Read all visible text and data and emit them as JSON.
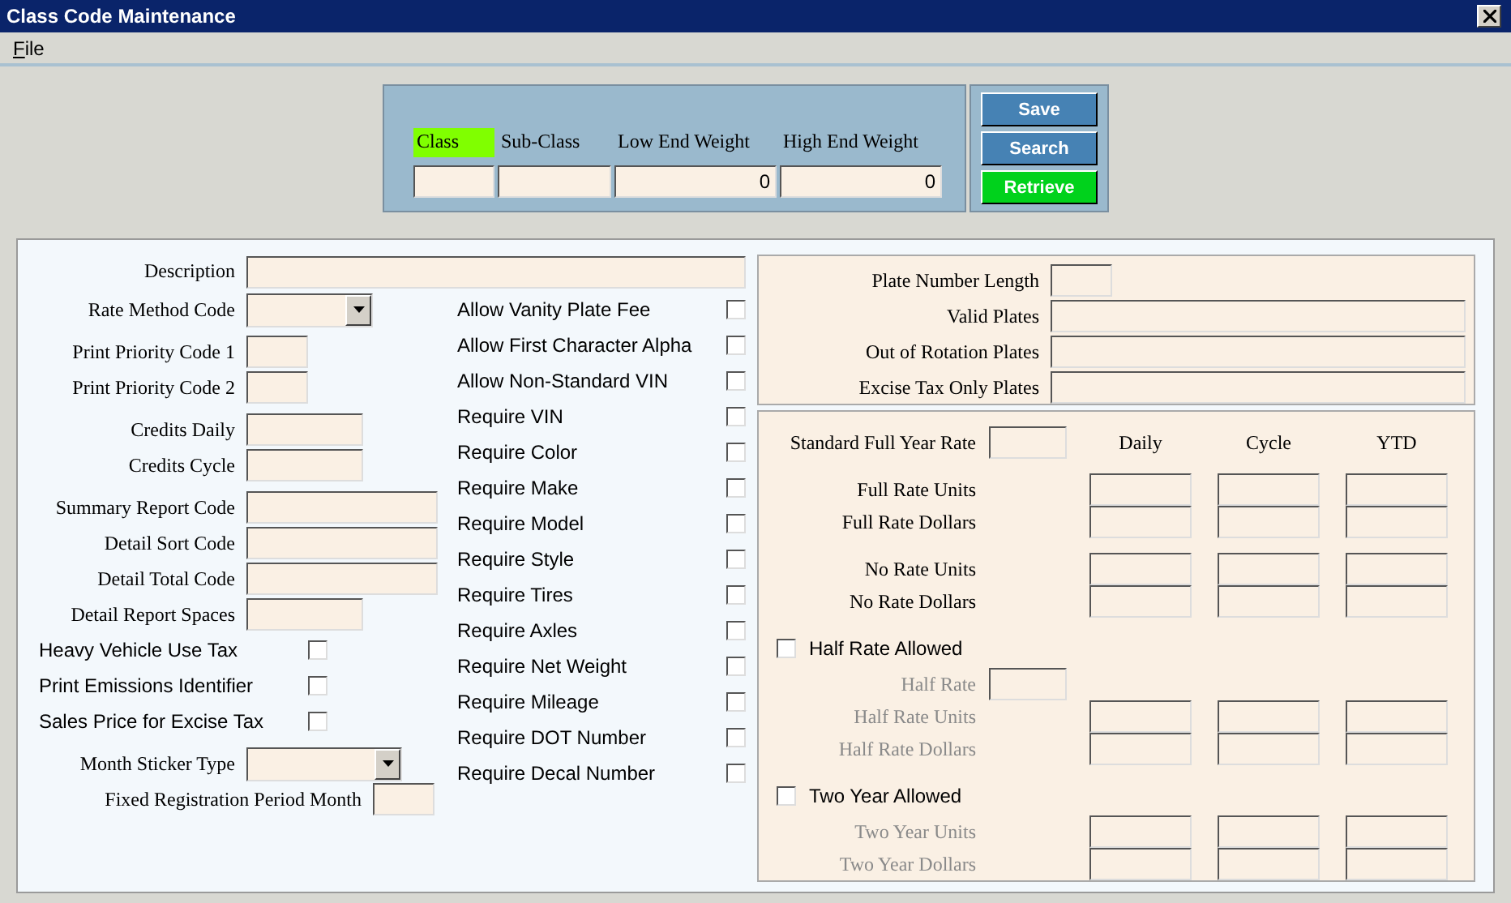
{
  "window": {
    "title": "Class Code Maintenance"
  },
  "menu": [
    {
      "label": "File"
    }
  ],
  "header": {
    "fields": [
      {
        "label": "Class",
        "highlighted": true
      },
      {
        "label": "Sub-Class",
        "highlighted": false
      },
      {
        "label": "Low End Weight",
        "value": "0",
        "highlighted": false
      },
      {
        "label": "High End Weight",
        "value": "0",
        "highlighted": false
      }
    ],
    "buttons": [
      {
        "label": "Save",
        "kind": "normal"
      },
      {
        "label": "Search",
        "kind": "normal"
      },
      {
        "label": "Retrieve",
        "kind": "primary"
      }
    ]
  },
  "description": {
    "label": "Description"
  },
  "left_groups": [
    {
      "fields": [
        {
          "kind": "combo",
          "label": "Rate Method Code"
        }
      ]
    },
    {
      "fields": [
        {
          "kind": "tiny",
          "label": "Print Priority Code 1"
        },
        {
          "kind": "tiny",
          "label": "Print Priority Code 2"
        }
      ]
    },
    {
      "fields": [
        {
          "kind": "short",
          "label": "Credits Daily"
        },
        {
          "kind": "short",
          "label": "Credits Cycle"
        }
      ]
    },
    {
      "fields": [
        {
          "kind": "medium",
          "label": "Summary Report Code"
        },
        {
          "kind": "medium",
          "label": "Detail Sort Code"
        },
        {
          "kind": "medium",
          "label": "Detail Total Code"
        },
        {
          "kind": "short",
          "label": "Detail Report Spaces"
        },
        {
          "kind": "checkbox",
          "label": "Heavy Vehicle Use Tax",
          "checked": false
        },
        {
          "kind": "checkbox",
          "label": "Print Emissions Identifier",
          "checked": false
        },
        {
          "kind": "checkbox",
          "label": "Sales Price for Excise Tax",
          "checked": false
        }
      ]
    },
    {
      "fields": [
        {
          "kind": "dropdown",
          "label": "Month Sticker Type"
        },
        {
          "kind": "inline",
          "label": "Fixed Registration Period Month"
        }
      ]
    }
  ],
  "options": [
    {
      "label": "Allow Vanity Plate Fee",
      "checked": false
    },
    {
      "label": "Allow First Character Alpha",
      "checked": false
    },
    {
      "label": "Allow Non-Standard VIN",
      "checked": false
    },
    {
      "label": "Require VIN",
      "checked": false
    },
    {
      "label": "Require Color",
      "checked": false
    },
    {
      "label": "Require Make",
      "checked": false
    },
    {
      "label": "Require Model",
      "checked": false
    },
    {
      "label": "Require Style",
      "checked": false
    },
    {
      "label": "Require Tires",
      "checked": false
    },
    {
      "label": "Require Axles",
      "checked": false
    },
    {
      "label": "Require Net Weight",
      "checked": false
    },
    {
      "label": "Require Mileage",
      "checked": false
    },
    {
      "label": "Require DOT Number",
      "checked": false
    },
    {
      "label": "Require Decal Number",
      "checked": false
    }
  ],
  "plates": [
    {
      "kind": "short",
      "label": "Plate Number Length"
    },
    {
      "kind": "wide",
      "label": "Valid Plates"
    },
    {
      "kind": "wide",
      "label": "Out of Rotation Plates"
    },
    {
      "kind": "wide",
      "label": "Excise Tax Only Plates"
    }
  ],
  "rates": {
    "columns": [
      "Daily",
      "Cycle",
      "YTD"
    ],
    "standard": {
      "label": "Standard Full Year Rate"
    },
    "groups": [
      {
        "kind": "plain",
        "rows": [
          {
            "label": "Full Rate Units"
          },
          {
            "label": "Full Rate Dollars"
          }
        ]
      },
      {
        "kind": "plain",
        "rows": [
          {
            "label": "No Rate Units"
          },
          {
            "label": "No Rate Dollars"
          }
        ]
      },
      {
        "kind": "optional",
        "toggle": {
          "label": "Half Rate Allowed",
          "checked": false
        },
        "rate": {
          "label": "Half Rate"
        },
        "rows": [
          {
            "label": "Half Rate Units"
          },
          {
            "label": "Half Rate Dollars"
          }
        ]
      },
      {
        "kind": "optional",
        "toggle": {
          "label": "Two Year Allowed",
          "checked": false
        },
        "rows": [
          {
            "label": "Two Year Units"
          },
          {
            "label": "Two Year Dollars"
          }
        ]
      }
    ]
  }
}
